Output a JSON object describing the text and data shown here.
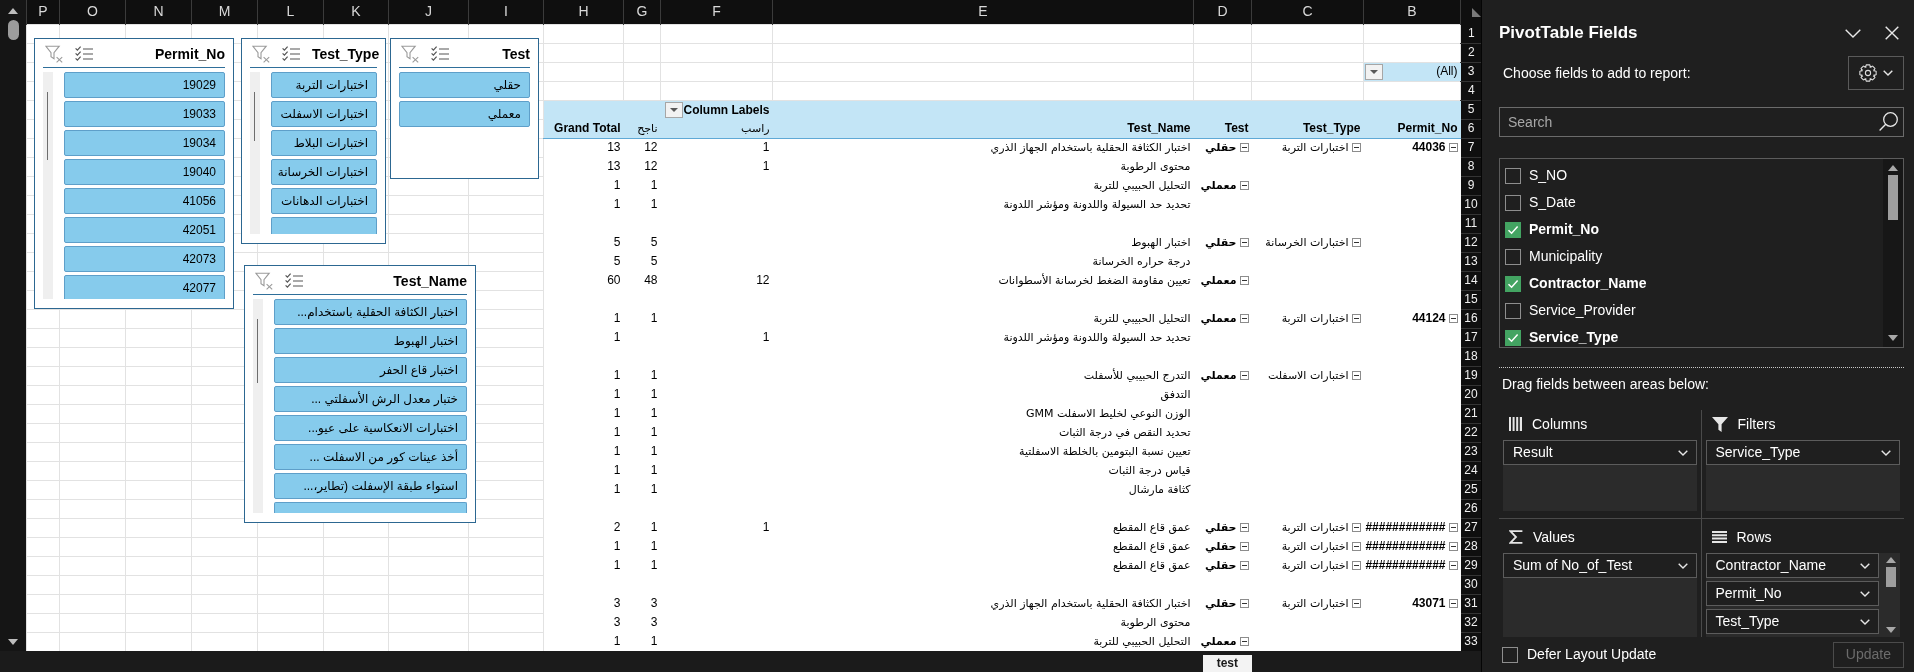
{
  "sheet": {
    "column_letters": [
      "B",
      "C",
      "D",
      "E",
      "F",
      "G",
      "H",
      "I",
      "J",
      "K",
      "L",
      "M",
      "N",
      "O",
      "P"
    ],
    "row_numbers": [
      "1",
      "2",
      "3",
      "4",
      "5",
      "6",
      "7",
      "8",
      "9",
      "10",
      "11",
      "12",
      "13",
      "14",
      "15",
      "16",
      "17",
      "18",
      "19",
      "20",
      "21",
      "22",
      "23",
      "24",
      "25",
      "26",
      "27",
      "28",
      "29",
      "30",
      "31",
      "32",
      "33"
    ]
  },
  "pivot": {
    "filter_value": "(All)",
    "column_labels": "Column Labels",
    "row_fields": [
      "Permit_No",
      "Test_Type",
      "Test",
      "Test_Name"
    ],
    "failed_header": "راسب",
    "passed_header": "ناجح",
    "grand_total": "Grand Total",
    "rows": [
      {
        "kind": "data",
        "permit_no": {
          "text": "44036",
          "expanded": true
        },
        "test_type": {
          "text": "اختبارات التربة",
          "expanded": true
        },
        "test": {
          "text": "حقلي",
          "expanded": true
        },
        "test_name": "اختبار الكثافة الحقلية باستخدام الجهاز الذري",
        "failed": "1",
        "passed": "12",
        "total": "13"
      },
      {
        "kind": "data",
        "test_name": "محتوى الرطوبة",
        "failed": "1",
        "passed": "12",
        "total": "13"
      },
      {
        "kind": "data",
        "test": {
          "text": "معملي",
          "expanded": true
        },
        "test_name": "التحليل الحبيبي للتربة",
        "passed": "1",
        "total": "1"
      },
      {
        "kind": "data",
        "test_name": "تحديد حد السيولة واللدونة ومؤشر اللدونة",
        "passed": "1",
        "total": "1"
      },
      {
        "kind": "blank"
      },
      {
        "kind": "data",
        "test_type": {
          "text": "اختبارات الخرسانة",
          "expanded": true
        },
        "test": {
          "text": "حقلي",
          "expanded": true
        },
        "test_name": "اختبار الهبوط",
        "passed": "5",
        "total": "5"
      },
      {
        "kind": "data",
        "test_name": "درجة حراره الخرسانة",
        "passed": "5",
        "total": "5"
      },
      {
        "kind": "data",
        "test": {
          "text": "معملي",
          "expanded": true
        },
        "test_name": "تعيين مقاومة الضغط لخرسانة الأسطوانات",
        "failed": "12",
        "passed": "48",
        "total": "60"
      },
      {
        "kind": "blank"
      },
      {
        "kind": "data",
        "permit_no": {
          "text": "44124",
          "expanded": true
        },
        "test_type": {
          "text": "اختبارات التربة",
          "expanded": true
        },
        "test": {
          "text": "معملي",
          "expanded": true
        },
        "test_name": "التحليل الحبيبي للتربة",
        "passed": "1",
        "total": "1"
      },
      {
        "kind": "data",
        "test_name": "تحديد حد السيولة واللدونة ومؤشر اللدونة",
        "failed": "1",
        "total": "1"
      },
      {
        "kind": "blank"
      },
      {
        "kind": "data",
        "test_type": {
          "text": "اختبارات الاسفلت",
          "expanded": true
        },
        "test": {
          "text": "معملي",
          "expanded": true
        },
        "test_name": "التدرج الحبيبي للأسفلت",
        "passed": "1",
        "total": "1"
      },
      {
        "kind": "data",
        "test_name": "التدفق",
        "passed": "1",
        "total": "1"
      },
      {
        "kind": "data",
        "test_name": "الوزن النوعي لخليط الاسفلت GMM",
        "passed": "1",
        "total": "1"
      },
      {
        "kind": "data",
        "test_name": "تحديد النقص في درجة الثبات",
        "passed": "1",
        "total": "1"
      },
      {
        "kind": "data",
        "test_name": "تعيين نسبة البتومين بالخلطة الاسفلتية",
        "passed": "1",
        "total": "1"
      },
      {
        "kind": "data",
        "test_name": "قياس درجة الثبات",
        "passed": "1",
        "total": "1"
      },
      {
        "kind": "data",
        "test_name": "كثافة مارشال",
        "passed": "1",
        "total": "1"
      },
      {
        "kind": "blank"
      },
      {
        "kind": "data",
        "permit_no": {
          "text": "############",
          "expanded": true
        },
        "test_type": {
          "text": "اختبارات التربة",
          "expanded": true
        },
        "test": {
          "text": "حقلي",
          "expanded": true
        },
        "test_name": "عمق قاع المقطع",
        "failed": "1",
        "passed": "1",
        "total": "2"
      },
      {
        "kind": "data",
        "permit_no": {
          "text": "############",
          "expanded": true
        },
        "test_type": {
          "text": "اختبارات التربة",
          "expanded": true
        },
        "test": {
          "text": "حقلي",
          "expanded": true
        },
        "test_name": "عمق قاع المقطع",
        "passed": "1",
        "total": "1"
      },
      {
        "kind": "data",
        "permit_no": {
          "text": "############",
          "expanded": true
        },
        "test_type": {
          "text": "اختبارات التربة",
          "expanded": true
        },
        "test": {
          "text": "حقلي",
          "expanded": true
        },
        "test_name": "عمق قاع المقطع",
        "passed": "1",
        "total": "1"
      },
      {
        "kind": "blank"
      },
      {
        "kind": "data",
        "permit_no": {
          "text": "43071",
          "expanded": true
        },
        "test_type": {
          "text": "اختبارات التربة",
          "expanded": true
        },
        "test": {
          "text": "حقلي",
          "expanded": true
        },
        "test_name": "اختبار الكثافة الحقلية باستخدام الجهاز الذري",
        "passed": "3",
        "total": "3"
      },
      {
        "kind": "data",
        "test_name": "محتوى الرطوبة",
        "passed": "3",
        "total": "3"
      },
      {
        "kind": "data",
        "test": {
          "text": "معملي",
          "expanded": true
        },
        "test_name": "التحليل الحبيبي للتربة",
        "passed": "1",
        "total": "1"
      }
    ]
  },
  "slicers": [
    {
      "title": "Test",
      "scrollable": false,
      "items": [
        {
          "label": "حقلي",
          "selected": true
        },
        {
          "label": "معملي",
          "selected": true
        }
      ]
    },
    {
      "title": "Test_Type",
      "scrollable": true,
      "items": [
        {
          "label": "اختبارات التربة",
          "selected": true
        },
        {
          "label": "اختبارات الاسفلت",
          "selected": true
        },
        {
          "label": "اختبارات البلاط",
          "selected": true
        },
        {
          "label": "اختبارات الخرسانة",
          "selected": true
        },
        {
          "label": "اختبارات الدهانات",
          "selected": true
        }
      ],
      "partial_item": true
    },
    {
      "title": "Permit_No",
      "scrollable": true,
      "items": [
        {
          "label": "19029",
          "selected": true
        },
        {
          "label": "19033",
          "selected": true
        },
        {
          "label": "19034",
          "selected": true
        },
        {
          "label": "19040",
          "selected": true
        },
        {
          "label": "41056",
          "selected": true
        },
        {
          "label": "42051",
          "selected": true
        },
        {
          "label": "42073",
          "selected": true
        },
        {
          "label": "42077",
          "selected": true
        }
      ]
    },
    {
      "title": "Test_Name",
      "scrollable": true,
      "items": [
        {
          "label": "اختبار الكثافة الحقلية باستخدام...",
          "selected": true
        },
        {
          "label": "اختبار الهبوط",
          "selected": true
        },
        {
          "label": "اختبار قاع الحفر",
          "selected": true
        },
        {
          "label": "ختبار معدل الرش الأسفلتي ...",
          "selected": true
        },
        {
          "label": "اختبارات الانعكاسية على عيو...",
          "selected": true
        },
        {
          "label": "أخذ عينات كور من الاسفلت ...",
          "selected": true
        },
        {
          "label": "استواء طبقة الإسفلت (تطاير،...",
          "selected": true
        }
      ],
      "partial_item": true
    }
  ],
  "pane": {
    "title": "PivotTable Fields",
    "subtitle": "Choose fields to add to report:",
    "search_placeholder": "Search",
    "fields": [
      {
        "name": "S_NO",
        "checked": false
      },
      {
        "name": "S_Date",
        "checked": false
      },
      {
        "name": "Permit_No",
        "checked": true
      },
      {
        "name": "Municipality",
        "checked": false
      },
      {
        "name": "Contractor_Name",
        "checked": true
      },
      {
        "name": "Service_Provider",
        "checked": false
      },
      {
        "name": "Service_Type",
        "checked": true
      }
    ],
    "areas_hint": "Drag fields between areas below:",
    "areas": [
      {
        "kind": "filters",
        "title": "Filters",
        "fields": [
          "Service_Type"
        ]
      },
      {
        "kind": "columns",
        "title": "Columns",
        "fields": [
          "Result"
        ]
      },
      {
        "kind": "rows",
        "title": "Rows",
        "fields": [
          "Contractor_Name",
          "Permit_No",
          "Test_Type"
        ]
      },
      {
        "kind": "values",
        "title": "Values",
        "fields": [
          "Sum of No_of_Test"
        ]
      }
    ],
    "defer_layout": {
      "label": "Defer Layout Update",
      "checked": false
    },
    "update_button": {
      "label": "Update",
      "disabled": true
    }
  },
  "status_bar": {
    "sheet_tabs": [
      {
        "label": "test",
        "selected": true
      }
    ]
  }
}
